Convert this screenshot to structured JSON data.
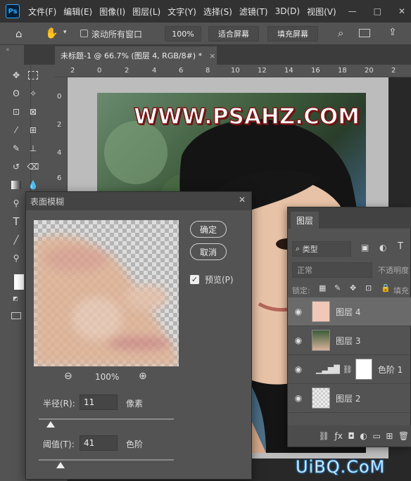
{
  "app": {
    "logo_text": "Ps"
  },
  "menu": [
    "文件(F)",
    "编辑(E)",
    "图像(I)",
    "图层(L)",
    "文字(Y)",
    "选择(S)",
    "滤镜(T)",
    "3D(D)",
    "视图(V)"
  ],
  "window_controls": [
    "—",
    "□",
    "✕"
  ],
  "options": {
    "scroll_all": "滚动所有窗口",
    "zoom": "100%",
    "fit_screen": "适合屏幕",
    "fill_screen": "填充屏幕"
  },
  "doc_tab": {
    "title": "未标题-1 @ 66.7% (图层 4, RGB/8#) *",
    "close": "×"
  },
  "ruler_top": [
    "2",
    "0",
    "2",
    "4",
    "6",
    "8",
    "10",
    "12",
    "14",
    "16",
    "18",
    "20",
    "2"
  ],
  "ruler_left": [
    "0",
    "2",
    "4",
    "6"
  ],
  "canvas": {
    "watermark": "WWW.PSAHZ.COM"
  },
  "dialog": {
    "title": "表面模糊",
    "close": "✕",
    "ok": "确定",
    "cancel": "取消",
    "preview_label": "预览(P)",
    "preview_checked": true,
    "zoom_out": "−",
    "zoom_in": "+",
    "zoom": "100%",
    "radius_label": "半径(R):",
    "radius_value": "11",
    "radius_unit": "像素",
    "radius_level": 0.09,
    "threshold_label": "阈值(T):",
    "threshold_value": "41",
    "threshold_unit": "色阶",
    "threshold_level": 0.16
  },
  "layers_panel": {
    "tab": "图层",
    "filter_kind": "类型",
    "blend_mode": "正常",
    "opacity_label": "不透明度",
    "lock_label": "锁定:",
    "fill_label": "填充",
    "layers": [
      {
        "name": "图层 4",
        "selected": true
      },
      {
        "name": "图层 3",
        "selected": false
      },
      {
        "name": "色阶 1",
        "selected": false
      },
      {
        "name": "图层 2",
        "selected": false
      }
    ],
    "footer_icons": [
      "link-icon",
      "fx-icon",
      "mask-icon",
      "adjustment-icon",
      "folder-icon",
      "new-layer-icon",
      "trash-icon"
    ]
  },
  "footer_watermark": "UiBQ.CoM"
}
